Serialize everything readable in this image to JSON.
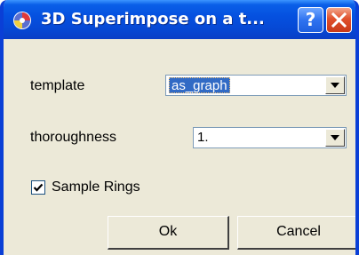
{
  "window": {
    "title": "3D Superimpose on a t...",
    "icon": "app-swirl-icon",
    "help_label": "?",
    "close_icon": "close-icon"
  },
  "form": {
    "template": {
      "label": "template",
      "value": "as_graph"
    },
    "thoroughness": {
      "label": "thoroughness",
      "value": "1."
    },
    "sample_rings": {
      "label": "Sample Rings",
      "checked": true
    }
  },
  "buttons": {
    "ok": "Ok",
    "cancel": "Cancel"
  },
  "colors": {
    "titlebar": "#0551e0",
    "dialog_bg": "#ece9d8",
    "selection": "#316ac5",
    "close_button": "#e0502c"
  }
}
